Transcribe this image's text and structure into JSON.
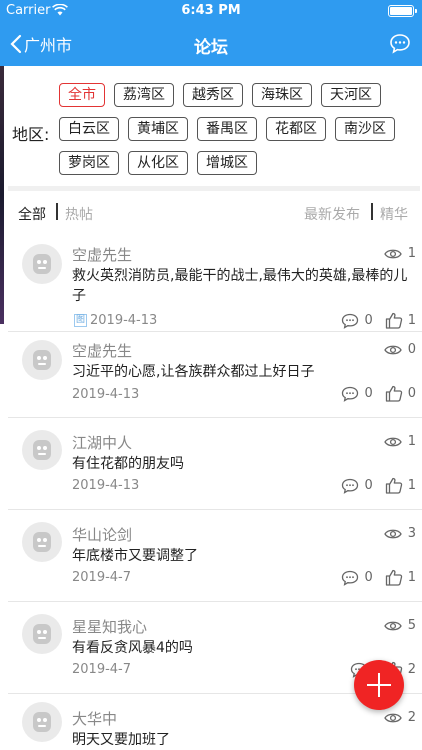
{
  "status": {
    "carrier": "Carrier",
    "time": "6:43 PM"
  },
  "nav": {
    "back_label": "广州市",
    "title": "论坛"
  },
  "region": {
    "label": "地区:",
    "tags": [
      "全市",
      "荔湾区",
      "越秀区",
      "海珠区",
      "天河区",
      "白云区",
      "黄埔区",
      "番禺区",
      "花都区",
      "南沙区",
      "萝岗区",
      "从化区",
      "增城区"
    ],
    "selected": "全市"
  },
  "filters": {
    "all": "全部",
    "hot": "热帖",
    "newest": "最新发布",
    "best": "精华"
  },
  "posts": [
    {
      "author": "空虚先生",
      "title": "救火英烈消防员,最能干的战士,最伟大的英雄,最棒的儿子",
      "date": "2019-4-13",
      "has_image": true,
      "image_tag": "图",
      "views": "1",
      "comments": "0",
      "likes": "1"
    },
    {
      "author": "空虚先生",
      "title": "习近平的心愿,让各族群众都过上好日子",
      "date": "2019-4-13",
      "has_image": false,
      "views": "0",
      "comments": "0",
      "likes": "0"
    },
    {
      "author": "江湖中人",
      "title": "有住花都的朋友吗",
      "date": "2019-4-13",
      "has_image": false,
      "views": "1",
      "comments": "0",
      "likes": "1"
    },
    {
      "author": "华山论剑",
      "title": "年底楼市又要调整了",
      "date": "2019-4-7",
      "has_image": false,
      "views": "3",
      "comments": "0",
      "likes": "1"
    },
    {
      "author": "星星知我心",
      "title": "有看反贪风暴4的吗",
      "date": "2019-4-7",
      "has_image": false,
      "views": "5",
      "comments": "",
      "likes": "2"
    },
    {
      "author": "大华中",
      "title": "明天又要加班了",
      "date": "",
      "has_image": false,
      "views": "2",
      "comments": "",
      "likes": ""
    }
  ],
  "colors": {
    "primary": "#2f9bf0",
    "accent": "#e23434",
    "fab": "#f02424"
  },
  "icons": {
    "back": "chevron-left-icon",
    "message": "chat-bubble-icon",
    "view": "eye-icon",
    "comment": "comment-icon",
    "like": "thumb-up-icon",
    "add": "plus-icon"
  }
}
